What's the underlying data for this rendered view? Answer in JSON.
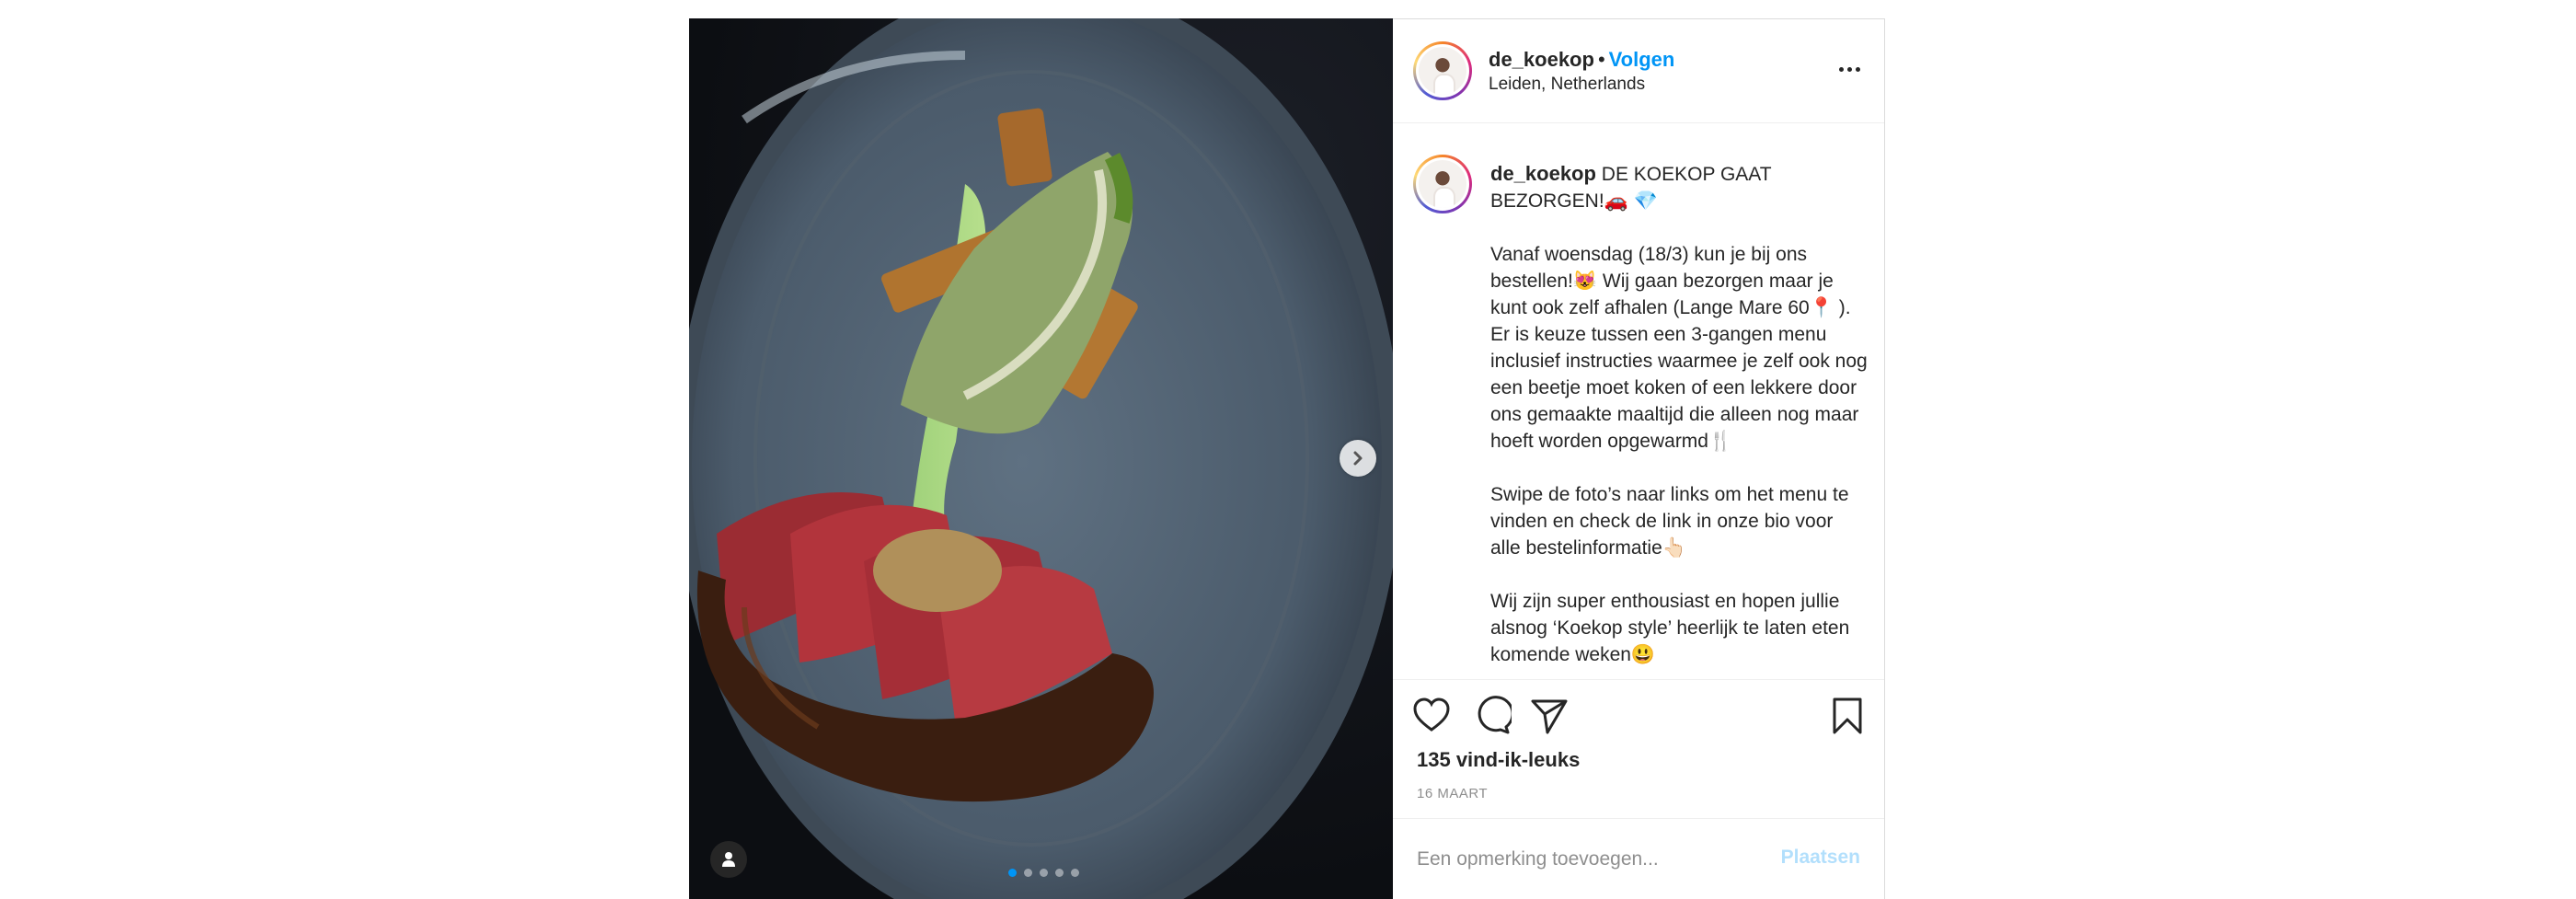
{
  "post": {
    "username": "de_koekop",
    "separator": "•",
    "follow_label": "Volgen",
    "location": "Leiden, Netherlands",
    "caption_lines": [
      "DE KOEKOP GAAT BEZORGEN!🚗 💎",
      "Vanaf woensdag (18/3) kun je bij ons bestellen!😻  Wij gaan bezorgen maar je kunt ook zelf afhalen (Lange Mare 60📍 ). Er is keuze tussen een 3-gangen menu inclusief instructies waarmee je zelf ook nog een beetje moet koken of een lekkere door ons gemaakte maaltijd die alleen nog maar hoeft worden opgewarmd🍴",
      "Swipe de foto’s naar links om het menu te vinden en check de link in onze bio voor alle bestelinformatie👆🏻",
      "Wij zijn super enthousiast en hopen jullie alsnog ‘Koekop style’ heerlijk te laten eten komende weken😃"
    ],
    "likes": "135 vind-ik-leuks",
    "date": "16 MAART"
  },
  "comment": {
    "placeholder": "Een opmerking toevoegen...",
    "post_label": "Plaatsen"
  },
  "carousel": {
    "slide_count": 5,
    "active_index": 0
  },
  "icons": {
    "like": "heart-icon",
    "comment": "comment-bubble-icon",
    "share": "paper-plane-icon",
    "save": "bookmark-icon",
    "more": "more-options-icon",
    "next": "chevron-right-icon",
    "tag": "person-tag-icon"
  },
  "colors": {
    "link": "#0095f6",
    "post_disabled": "#b2dffc",
    "muted": "#8e8e8e",
    "text": "#262626"
  }
}
